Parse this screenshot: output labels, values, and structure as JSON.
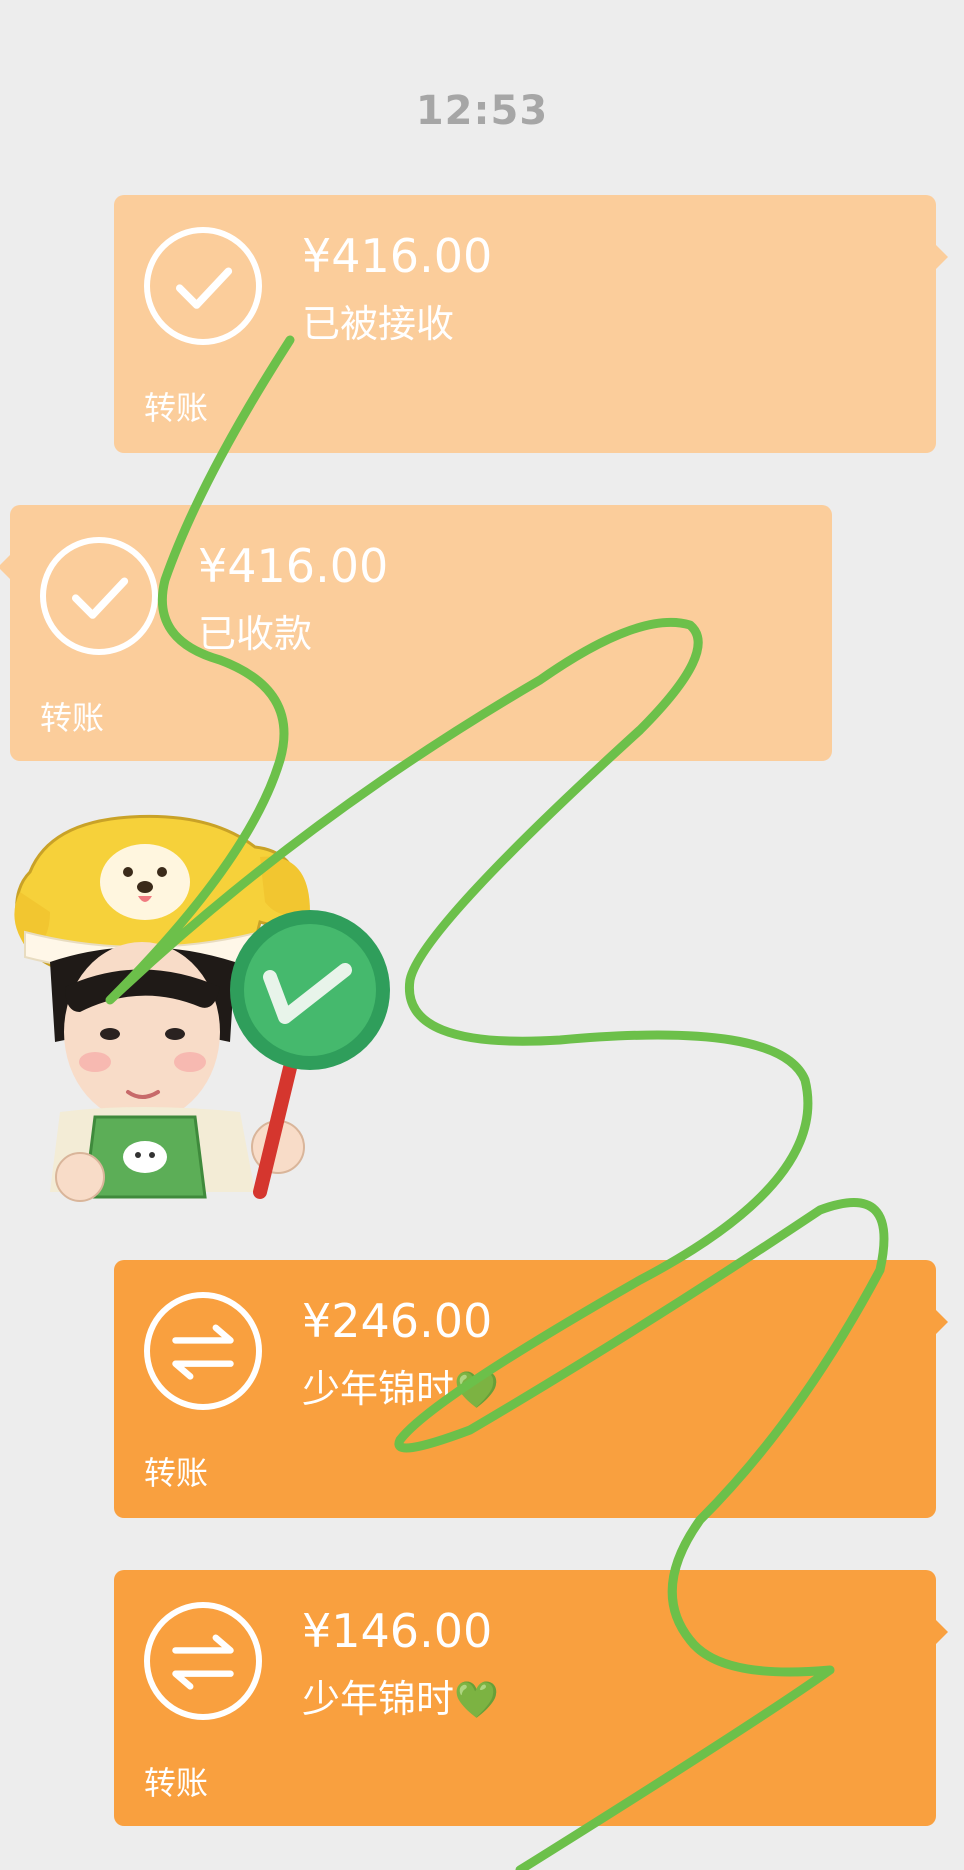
{
  "time": "12:53",
  "messages": [
    {
      "amount": "¥416.00",
      "status": "已被接收",
      "label": "转账",
      "icon": "check-icon",
      "side": "right",
      "style": "light"
    },
    {
      "amount": "¥416.00",
      "status": "已收款",
      "label": "转账",
      "icon": "check-icon",
      "side": "left",
      "style": "light"
    },
    {
      "amount": "¥246.00",
      "status": "少年锦时",
      "heart": "💚",
      "label": "转账",
      "icon": "transfer-arrows-icon",
      "side": "right",
      "style": "dark"
    },
    {
      "amount": "¥146.00",
      "status": "少年锦时",
      "heart": "💚",
      "label": "转账",
      "icon": "transfer-arrows-icon",
      "side": "right",
      "style": "dark"
    }
  ],
  "sticker": {
    "icon": "boy-holding-check-sign-sticker"
  },
  "colors": {
    "background": "#ededed",
    "bubble_light": "#fbcd9b",
    "bubble_dark": "#f9a03f",
    "scribble": "#6cc04a",
    "timestamp": "#a6a6a6"
  }
}
